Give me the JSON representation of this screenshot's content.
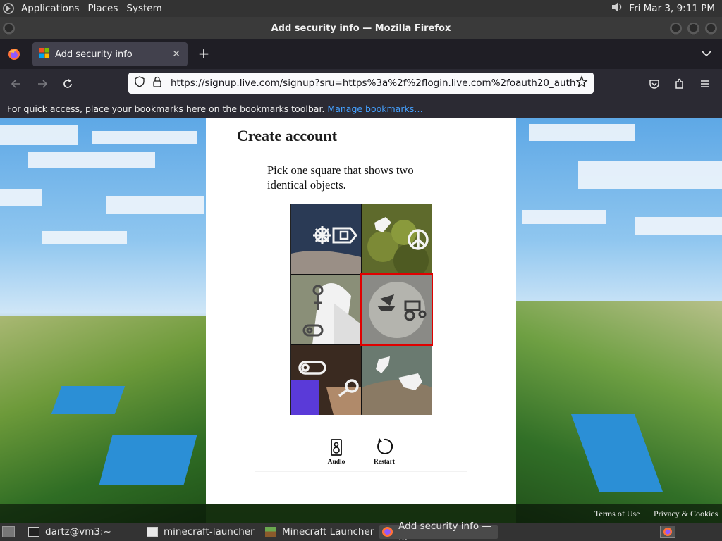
{
  "panel": {
    "menus": [
      "Applications",
      "Places",
      "System"
    ],
    "clock": "Fri Mar  3,  9:11 PM"
  },
  "window": {
    "title": "Add security info — Mozilla Firefox"
  },
  "tabs": [
    {
      "label": "Add security info"
    }
  ],
  "navbar": {
    "url": "https://signup.live.com/signup?sru=https%3a%2f%2flogin.live.com%2foauth20_authorize"
  },
  "bookmarks": {
    "message": "For quick access, place your bookmarks here on the bookmarks toolbar.",
    "manage_link": "Manage bookmarks…"
  },
  "page": {
    "title": "Create account",
    "instruction": "Pick one square that shows two identical objects.",
    "grid": [
      {
        "id": 1,
        "icons": [
          "ship-wheel-icon",
          "mail-box-icon"
        ],
        "selected": false
      },
      {
        "id": 2,
        "icons": [
          "bottle-icon",
          "peace-sign-icon"
        ],
        "selected": false
      },
      {
        "id": 3,
        "icons": [
          "key-lock-icon",
          "whistle-icon"
        ],
        "selected": false
      },
      {
        "id": 4,
        "icons": [
          "sailboat-icon",
          "tractor-icon"
        ],
        "selected": true
      },
      {
        "id": 5,
        "icons": [
          "cannon-icon",
          "magnifier-icon"
        ],
        "selected": false
      },
      {
        "id": 6,
        "icons": [
          "bird-icon",
          "hand-icon"
        ],
        "selected": false
      }
    ],
    "audio_label": "Audio",
    "restart_label": "Restart"
  },
  "footer": {
    "terms": "Terms of Use",
    "privacy": "Privacy & Cookies"
  },
  "taskbar": [
    {
      "label": "dartz@vm3:~",
      "icon": "terminal-icon"
    },
    {
      "label": "minecraft-launcher",
      "icon": "window-icon"
    },
    {
      "label": "Minecraft Launcher",
      "icon": "minecraft-icon"
    },
    {
      "label": "Add security info — ...",
      "icon": "firefox-icon"
    }
  ],
  "colors": {
    "selection": "#e00000",
    "link": "#45a1ff",
    "panel": "#333333"
  }
}
